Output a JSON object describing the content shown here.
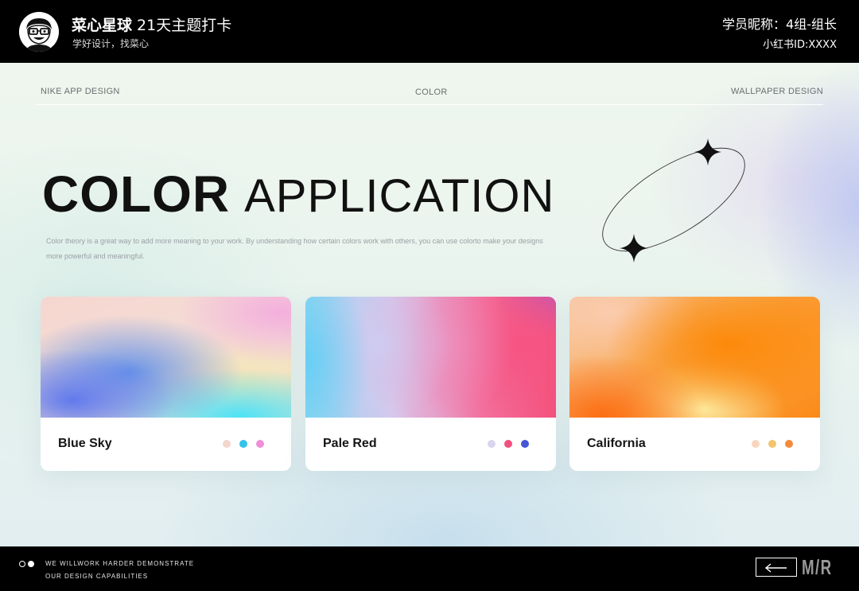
{
  "header": {
    "brand": "菜心星球",
    "title": "21天主题打卡",
    "subtitle": "学好设计，找菜心",
    "student_label": "学员昵称：4组-组长",
    "student_id": "小红书ID:XXXX"
  },
  "nav": {
    "left": "NIKE APP DESIGN",
    "center": "COLOR",
    "right": "WALLPAPER DESIGN"
  },
  "hero": {
    "title_bold": "COLOR",
    "title_light": "APPLICATION",
    "description": "Color theory is a great way to add more meaning to your work. By understanding how certain colors work with others, you can use colorto make your designs more powerful and meaningful."
  },
  "cards": [
    {
      "label": "Blue Sky",
      "dots": [
        "#f3d6cc",
        "#35c2e8",
        "#ee8fd8"
      ]
    },
    {
      "label": "Pale Red",
      "dots": [
        "#d8d6ee",
        "#f2507e",
        "#4656d6"
      ]
    },
    {
      "label": "California",
      "dots": [
        "#f8d6be",
        "#f4c46e",
        "#f58a3c"
      ]
    }
  ],
  "footer": {
    "line1": "WE WILLWORK HARDER DEMONSTRATE",
    "line2": "OUR DESIGN CAPABILITIES",
    "mark": "M/R"
  },
  "icons": {
    "avatar": "cartoon-avatar-icon",
    "sparkle": "four-point-star-icon",
    "back": "left-arrow-icon"
  },
  "colors": {
    "header_bg": "#000000",
    "text_dark": "#111111",
    "accent_muted": "#9aa0a4"
  }
}
